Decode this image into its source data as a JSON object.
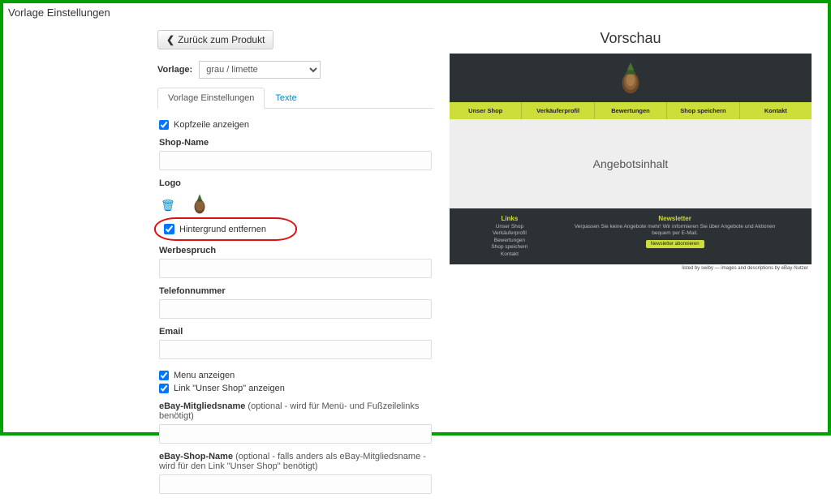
{
  "page": {
    "title": "Vorlage Einstellungen"
  },
  "back": {
    "label": "Zurück zum Produkt"
  },
  "vorlage": {
    "label": "Vorlage:",
    "selected": "grau / limette"
  },
  "tabs": {
    "settings": "Vorlage Einstellungen",
    "texts": "Texte"
  },
  "form": {
    "kopfzeile": "Kopfzeile anzeigen",
    "shopname_label": "Shop-Name",
    "shopname_value": "",
    "logo_label": "Logo",
    "hintergrund": "Hintergrund entfernen",
    "werbespruch_label": "Werbespruch",
    "werbespruch_value": "",
    "telefon_label": "Telefonnummer",
    "telefon_value": "",
    "email_label": "Email",
    "email_value": "",
    "menu_anzeigen": "Menu anzeigen",
    "link_unsershop": "Link \"Unser Shop\" anzeigen",
    "ebay_mitglied_label": "eBay-Mitgliedsname",
    "ebay_mitglied_sub": " (optional - wird für Menü- und Fußzeilelinks benötigt)",
    "ebay_mitglied_value": "",
    "ebay_shop_label": "eBay-Shop-Name",
    "ebay_shop_sub": " (optional - falls anders als eBay-Mitgliedsname - wird für den Link \"Unser Shop\" benötigt)",
    "ebay_shop_value": ""
  },
  "preview": {
    "title": "Vorschau",
    "nav": {
      "unser_shop": "Unser Shop",
      "verkaufer": "Verkäuferprofil",
      "bewertungen": "Bewertungen",
      "speichern": "Shop speichern",
      "kontakt": "Kontakt"
    },
    "body": "Angebotsinhalt",
    "footer": {
      "links_hd": "Links",
      "links": {
        "a": "Unser Shop",
        "b": "Verkäuferprofil",
        "c": "Bewertungen",
        "d": "Shop speichern",
        "e": "Kontakt"
      },
      "news_hd": "Newsletter",
      "news_txt": "Verpassen Sie keine Angebote mehr! Wir informieren Sie über Angebote und Aktionen bequem per E-Mail.",
      "news_btn": "Newsletter abonnieren"
    },
    "credits": "listed by swiby — images and descriptions by eBay-Nutzer"
  },
  "icons": {
    "chevron_left": "❮",
    "trash": "🗑"
  }
}
